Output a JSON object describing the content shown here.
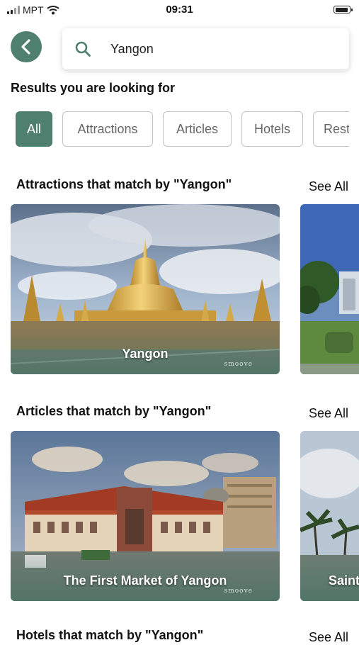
{
  "status": {
    "carrier": "MPT",
    "time": "09:31"
  },
  "search": {
    "query": "Yangon"
  },
  "results_title": "Results you are looking for",
  "chips": [
    "All",
    "Attractions",
    "Articles",
    "Hotels",
    "Rest"
  ],
  "sections": {
    "attractions": {
      "title": "Attractions that match by \"Yangon\"",
      "see_all": "See All",
      "card1_label": "Yangon",
      "card1_watermark": "smoove"
    },
    "articles": {
      "title": "Articles that match by \"Yangon\"",
      "see_all": "See All",
      "card1_label": "The First Market of Yangon",
      "card1_watermark": "smoove",
      "card2_label": "Saint"
    },
    "hotels": {
      "title": "Hotels that match by \"Yangon\"",
      "see_all": "See All"
    }
  },
  "colors": {
    "accent": "#4f7f6e"
  }
}
